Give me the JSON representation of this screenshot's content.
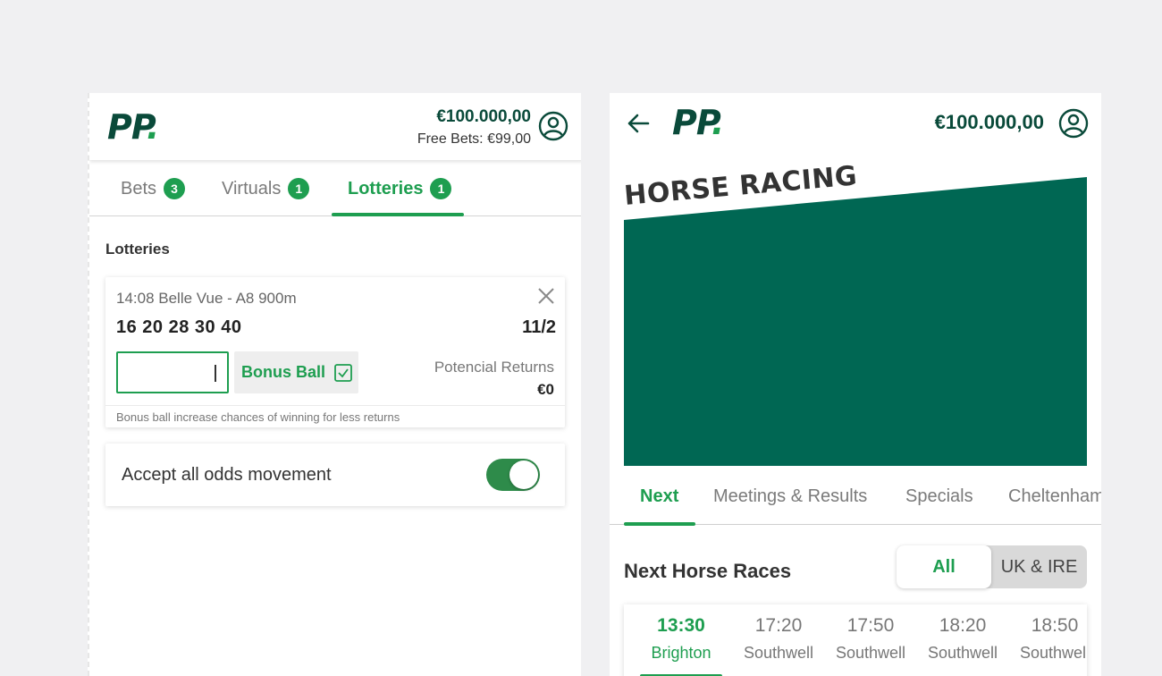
{
  "left": {
    "header": {
      "logo_main": "PP",
      "logo_dot": ".",
      "balance": "€100.000,00",
      "free_bets": "Free Bets: €99,00",
      "icon": "user-circle-icon"
    },
    "tabs": [
      {
        "label": "Bets",
        "count": "3",
        "active": false
      },
      {
        "label": "Virtuals",
        "count": "1",
        "active": false
      },
      {
        "label": "Lotteries",
        "count": "1",
        "active": true
      }
    ],
    "section_title": "Lotteries",
    "lottery_card": {
      "race": "14:08 Belle Vue - A8 900m",
      "numbers": "16 20 28 30 40",
      "odds": "11/2",
      "stake_value": "",
      "bonus_ball_label": "Bonus Ball",
      "bonus_ball_checked": true,
      "returns_label": "Potencial Returns",
      "returns_value": "€0",
      "hint": "Bonus ball increase chances of winning for less returns"
    },
    "odds_movement": {
      "label": "Accept all odds movement",
      "enabled": true
    }
  },
  "right": {
    "header": {
      "logo_main": "PP",
      "logo_dot": ".",
      "balance": "€100.000,00",
      "icon": "user-circle-icon"
    },
    "hero_title": "HORSE RACING",
    "tabs": [
      {
        "label": "Next",
        "active": true
      },
      {
        "label": "Meetings & Results",
        "active": false
      },
      {
        "label": "Specials",
        "active": false
      },
      {
        "label": "Cheltenham",
        "active": false
      }
    ],
    "next_title": "Next Horse Races",
    "filter": {
      "all": "All",
      "uk": "UK & IRE",
      "selected": "All"
    },
    "races": [
      {
        "time": "13:30",
        "venue": "Brighton",
        "active": true
      },
      {
        "time": "17:20",
        "venue": "Southwell",
        "active": false
      },
      {
        "time": "17:50",
        "venue": "Southwell",
        "active": false
      },
      {
        "time": "18:20",
        "venue": "Southwell",
        "active": false
      },
      {
        "time": "18:50",
        "venue": "Southwell",
        "active": false
      }
    ]
  },
  "colors": {
    "brand_green": "#1e9e50",
    "dark_green": "#0a4a3a",
    "hero_green": "#006753"
  }
}
